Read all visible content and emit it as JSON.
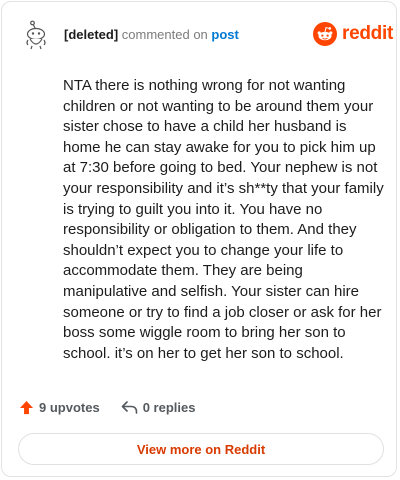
{
  "header": {
    "author": "[deleted]",
    "action": "commented on",
    "target": "post"
  },
  "logo": {
    "text": "reddit",
    "icon": "reddit-alien-icon",
    "color": "#ff4500"
  },
  "avatar": {
    "icon": "deleted-user-avatar-icon"
  },
  "comment": {
    "body": "NTA there is nothing wrong for not wanting children or not wanting to be around them your sister chose to have a child her husband is home he can stay awake for you to pick him up at 7:30 before going to bed. Your nephew is not your responsibility and it’s sh**ty that your family is trying to guilt you into it. You have no responsibility or obligation to them. And they shouldn’t expect you to change your life to accommodate them. They are being manipulative and selfish. Your sister can hire someone or try to find a job closer or ask for her boss some wiggle room to bring her son to school. it’s on her to get her son to school."
  },
  "footer": {
    "upvotes": "9 upvotes",
    "upvote_icon": "upvote-arrow-icon",
    "replies": "0 replies",
    "reply_icon": "reply-arrow-icon"
  },
  "cta": {
    "label": "View more on Reddit"
  },
  "colors": {
    "accent": "#ff4500",
    "link": "#0079d3",
    "cta_text": "#d93a00",
    "border": "#e1e3e6"
  }
}
